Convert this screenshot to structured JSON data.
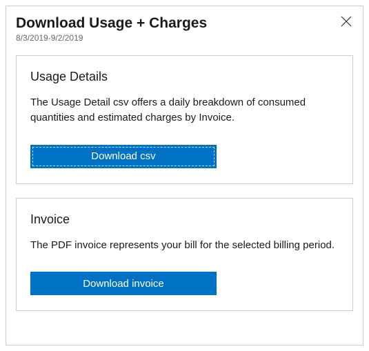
{
  "header": {
    "title": "Download Usage + Charges",
    "date_range": "8/3/2019-9/2/2019"
  },
  "cards": {
    "usage": {
      "title": "Usage Details",
      "description": "The Usage Detail csv offers a daily breakdown of consumed quantities and estimated charges by Invoice.",
      "button_label": "Download csv"
    },
    "invoice": {
      "title": "Invoice",
      "description": "The PDF invoice represents your bill for the selected billing period.",
      "button_label": "Download invoice"
    }
  },
  "colors": {
    "primary": "#0072c6"
  }
}
